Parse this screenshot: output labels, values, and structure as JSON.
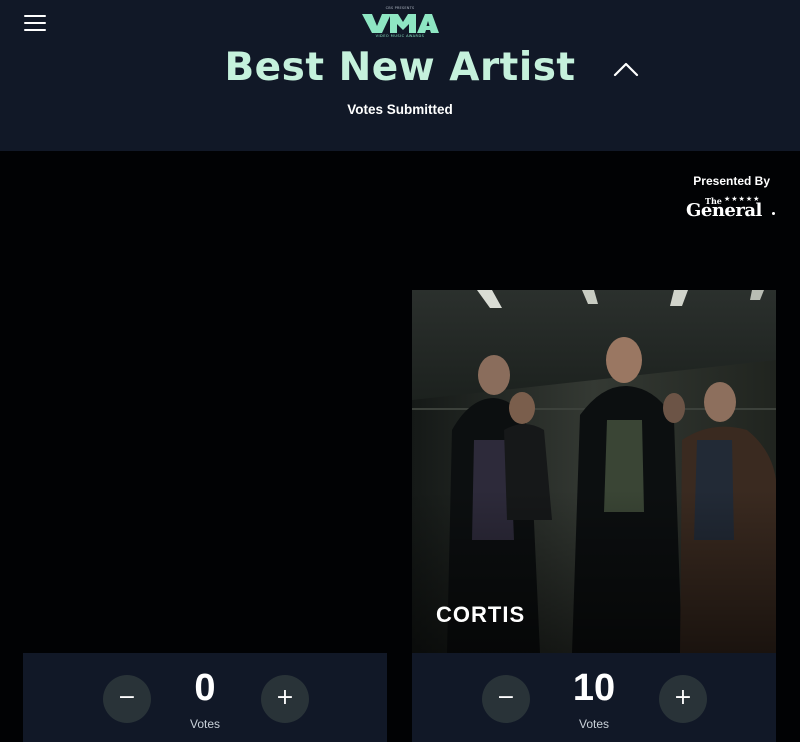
{
  "header": {
    "logo": {
      "top_text": "CBS PRESENTS",
      "wordmark": "VMA",
      "sub_text": "VIDEO MUSIC AWARDS"
    },
    "menu_icon": "hamburger-menu-icon",
    "category_title": "Best New Artist",
    "collapse_icon": "chevron-up-icon",
    "status": "Votes Submitted"
  },
  "sponsor": {
    "label": "Presented By",
    "brand_the": "The",
    "brand_stars": "★★★★★",
    "brand_name": "General"
  },
  "nominees": [
    {
      "name": "",
      "votes": "0",
      "votes_label": "Votes",
      "minus_label": "−",
      "plus_label": "+"
    },
    {
      "name": "CORTIS",
      "votes": "10",
      "votes_label": "Votes",
      "minus_label": "−",
      "plus_label": "+"
    }
  ],
  "colors": {
    "header_bg": "#111827",
    "page_bg": "#010204",
    "accent_mint": "#c5f1dc",
    "button_bg": "#293338"
  }
}
